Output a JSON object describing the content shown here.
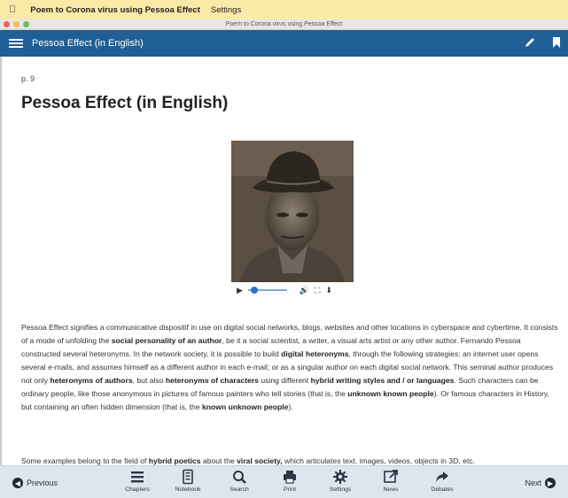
{
  "menubar": {
    "app": "Poem to Corona virus using Pessoa Effect",
    "settings": "Settings"
  },
  "window": {
    "title": "Poem to Corona virus using Pessoa Effect"
  },
  "appbar": {
    "title": "Pessoa Effect (in English)",
    "actions": [
      "pencil-icon",
      "bookmark-icon"
    ]
  },
  "content": {
    "page": "p. 9",
    "heading": "Pessoa Effect (in English)",
    "p1": [
      "Pessoa Effect signifies a communicative dispositif in use on digital social networks, blogs, websites and other locations in cyberspace and cybertime. It consists of a mode of unfolding the ",
      "social personality of an author",
      ", be it a social scientist, a writer, a visual arts artist or any other author. Fernando Pessoa constructed several heteronyms. In the network society, it is possible to build ",
      "digital heteronyms",
      ", through the following strategies: an internet user opens several e-mails, and assumes himself as a different author in each e-mail; or as a singular author on each digital social network. This seminal author produces not only ",
      "heteronyms of authors",
      ", but also ",
      "heteronyms of characters",
      " using different ",
      "hybrid writing styles and / or languages",
      ". Such characters can be ordinary people, like those anonymous in pictures of famous painters who tell stories (that is, the ",
      "unknown known people",
      "). Or famous characters in History, but containing an often hidden dimension (that is, the ",
      "known unknown people",
      ")."
    ],
    "p2": [
      "Some examples belong to the field of ",
      "hybrid poetics",
      " about the ",
      "viral society,",
      " which articulates text, images, videos, objects in 3D, etc."
    ],
    "video": {
      "progress": 0.08
    }
  },
  "footer": {
    "previous": "Previous",
    "next": "Next",
    "tools": [
      {
        "label": "Chapters",
        "icon": "list-icon"
      },
      {
        "label": "Notebook",
        "icon": "notebook-icon"
      },
      {
        "label": "Search",
        "icon": "search-icon"
      },
      {
        "label": "Print",
        "icon": "print-icon"
      },
      {
        "label": "Settings",
        "icon": "gear-icon"
      },
      {
        "label": "News",
        "icon": "external-link-icon"
      },
      {
        "label": "Debates",
        "icon": "share-arrow-icon"
      }
    ]
  },
  "colors": {
    "appbar": "#1f5f95",
    "menubar": "#fbe9a8",
    "footer": "#dce6ef"
  }
}
